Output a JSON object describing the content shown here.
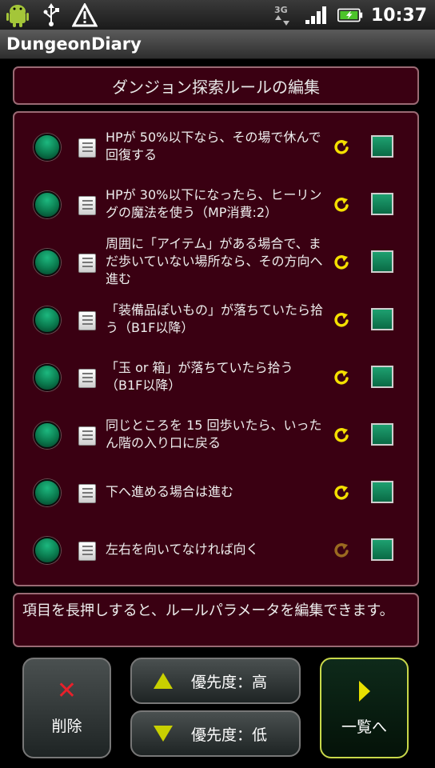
{
  "status_bar": {
    "clock": "10:37",
    "left_icons": [
      "android-icon",
      "usb-icon",
      "warning-icon"
    ],
    "right_icons": [
      "3g-icon",
      "signal-icon",
      "battery-icon"
    ]
  },
  "app": {
    "title": "DungeonDiary"
  },
  "header": {
    "title": "ダンジョン探索ルールの編集"
  },
  "rules": [
    {
      "label": "HPが 50%以下なら、その場で休んで回復する",
      "enabled": true,
      "arrow_color": "#f4e000"
    },
    {
      "label": "HPが 30%以下になったら、ヒーリングの魔法を使う（MP消費:2）",
      "enabled": true,
      "arrow_color": "#f4e000"
    },
    {
      "label": "周囲に「アイテム」がある場合で、まだ歩いていない場所なら、その方向へ進む",
      "enabled": true,
      "arrow_color": "#f4e000"
    },
    {
      "label": "「装備品ぽいもの」が落ちていたら拾う（B1F以降）",
      "enabled": true,
      "arrow_color": "#f4e000"
    },
    {
      "label": "「玉 or 箱」が落ちていたら拾う（B1F以降）",
      "enabled": true,
      "arrow_color": "#f4e000"
    },
    {
      "label": "同じところを 15 回歩いたら、いったん階の入り口に戻る",
      "enabled": true,
      "arrow_color": "#f4e000"
    },
    {
      "label": "下へ進める場合は進む",
      "enabled": true,
      "arrow_color": "#f4e000"
    },
    {
      "label": "左右を向いてなければ向く",
      "enabled": true,
      "arrow_color": "#9a6a20"
    }
  ],
  "hint": {
    "text": "項目を長押しすると、ルールパラメータを編集できます。"
  },
  "buttons": {
    "delete": "削除",
    "priority_high": "優先度：高",
    "priority_low": "優先度：低",
    "to_list": "一覧へ"
  },
  "colors": {
    "panel_bg": "#3a0012",
    "panel_border": "#9a6a74",
    "accent_green": "#0a7a4e",
    "arrow_yellow": "#f4e000"
  }
}
